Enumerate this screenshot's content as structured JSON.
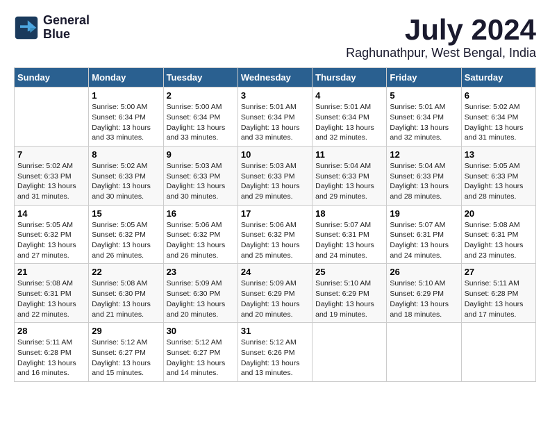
{
  "header": {
    "logo_line1": "General",
    "logo_line2": "Blue",
    "title": "July 2024",
    "location": "Raghunathpur, West Bengal, India"
  },
  "columns": [
    "Sunday",
    "Monday",
    "Tuesday",
    "Wednesday",
    "Thursday",
    "Friday",
    "Saturday"
  ],
  "weeks": [
    [
      {
        "day": "",
        "info": ""
      },
      {
        "day": "1",
        "info": "Sunrise: 5:00 AM\nSunset: 6:34 PM\nDaylight: 13 hours\nand 33 minutes."
      },
      {
        "day": "2",
        "info": "Sunrise: 5:00 AM\nSunset: 6:34 PM\nDaylight: 13 hours\nand 33 minutes."
      },
      {
        "day": "3",
        "info": "Sunrise: 5:01 AM\nSunset: 6:34 PM\nDaylight: 13 hours\nand 33 minutes."
      },
      {
        "day": "4",
        "info": "Sunrise: 5:01 AM\nSunset: 6:34 PM\nDaylight: 13 hours\nand 32 minutes."
      },
      {
        "day": "5",
        "info": "Sunrise: 5:01 AM\nSunset: 6:34 PM\nDaylight: 13 hours\nand 32 minutes."
      },
      {
        "day": "6",
        "info": "Sunrise: 5:02 AM\nSunset: 6:34 PM\nDaylight: 13 hours\nand 31 minutes."
      }
    ],
    [
      {
        "day": "7",
        "info": "Sunrise: 5:02 AM\nSunset: 6:33 PM\nDaylight: 13 hours\nand 31 minutes."
      },
      {
        "day": "8",
        "info": "Sunrise: 5:02 AM\nSunset: 6:33 PM\nDaylight: 13 hours\nand 30 minutes."
      },
      {
        "day": "9",
        "info": "Sunrise: 5:03 AM\nSunset: 6:33 PM\nDaylight: 13 hours\nand 30 minutes."
      },
      {
        "day": "10",
        "info": "Sunrise: 5:03 AM\nSunset: 6:33 PM\nDaylight: 13 hours\nand 29 minutes."
      },
      {
        "day": "11",
        "info": "Sunrise: 5:04 AM\nSunset: 6:33 PM\nDaylight: 13 hours\nand 29 minutes."
      },
      {
        "day": "12",
        "info": "Sunrise: 5:04 AM\nSunset: 6:33 PM\nDaylight: 13 hours\nand 28 minutes."
      },
      {
        "day": "13",
        "info": "Sunrise: 5:05 AM\nSunset: 6:33 PM\nDaylight: 13 hours\nand 28 minutes."
      }
    ],
    [
      {
        "day": "14",
        "info": "Sunrise: 5:05 AM\nSunset: 6:32 PM\nDaylight: 13 hours\nand 27 minutes."
      },
      {
        "day": "15",
        "info": "Sunrise: 5:05 AM\nSunset: 6:32 PM\nDaylight: 13 hours\nand 26 minutes."
      },
      {
        "day": "16",
        "info": "Sunrise: 5:06 AM\nSunset: 6:32 PM\nDaylight: 13 hours\nand 26 minutes."
      },
      {
        "day": "17",
        "info": "Sunrise: 5:06 AM\nSunset: 6:32 PM\nDaylight: 13 hours\nand 25 minutes."
      },
      {
        "day": "18",
        "info": "Sunrise: 5:07 AM\nSunset: 6:31 PM\nDaylight: 13 hours\nand 24 minutes."
      },
      {
        "day": "19",
        "info": "Sunrise: 5:07 AM\nSunset: 6:31 PM\nDaylight: 13 hours\nand 24 minutes."
      },
      {
        "day": "20",
        "info": "Sunrise: 5:08 AM\nSunset: 6:31 PM\nDaylight: 13 hours\nand 23 minutes."
      }
    ],
    [
      {
        "day": "21",
        "info": "Sunrise: 5:08 AM\nSunset: 6:31 PM\nDaylight: 13 hours\nand 22 minutes."
      },
      {
        "day": "22",
        "info": "Sunrise: 5:08 AM\nSunset: 6:30 PM\nDaylight: 13 hours\nand 21 minutes."
      },
      {
        "day": "23",
        "info": "Sunrise: 5:09 AM\nSunset: 6:30 PM\nDaylight: 13 hours\nand 20 minutes."
      },
      {
        "day": "24",
        "info": "Sunrise: 5:09 AM\nSunset: 6:29 PM\nDaylight: 13 hours\nand 20 minutes."
      },
      {
        "day": "25",
        "info": "Sunrise: 5:10 AM\nSunset: 6:29 PM\nDaylight: 13 hours\nand 19 minutes."
      },
      {
        "day": "26",
        "info": "Sunrise: 5:10 AM\nSunset: 6:29 PM\nDaylight: 13 hours\nand 18 minutes."
      },
      {
        "day": "27",
        "info": "Sunrise: 5:11 AM\nSunset: 6:28 PM\nDaylight: 13 hours\nand 17 minutes."
      }
    ],
    [
      {
        "day": "28",
        "info": "Sunrise: 5:11 AM\nSunset: 6:28 PM\nDaylight: 13 hours\nand 16 minutes."
      },
      {
        "day": "29",
        "info": "Sunrise: 5:12 AM\nSunset: 6:27 PM\nDaylight: 13 hours\nand 15 minutes."
      },
      {
        "day": "30",
        "info": "Sunrise: 5:12 AM\nSunset: 6:27 PM\nDaylight: 13 hours\nand 14 minutes."
      },
      {
        "day": "31",
        "info": "Sunrise: 5:12 AM\nSunset: 6:26 PM\nDaylight: 13 hours\nand 13 minutes."
      },
      {
        "day": "",
        "info": ""
      },
      {
        "day": "",
        "info": ""
      },
      {
        "day": "",
        "info": ""
      }
    ]
  ]
}
